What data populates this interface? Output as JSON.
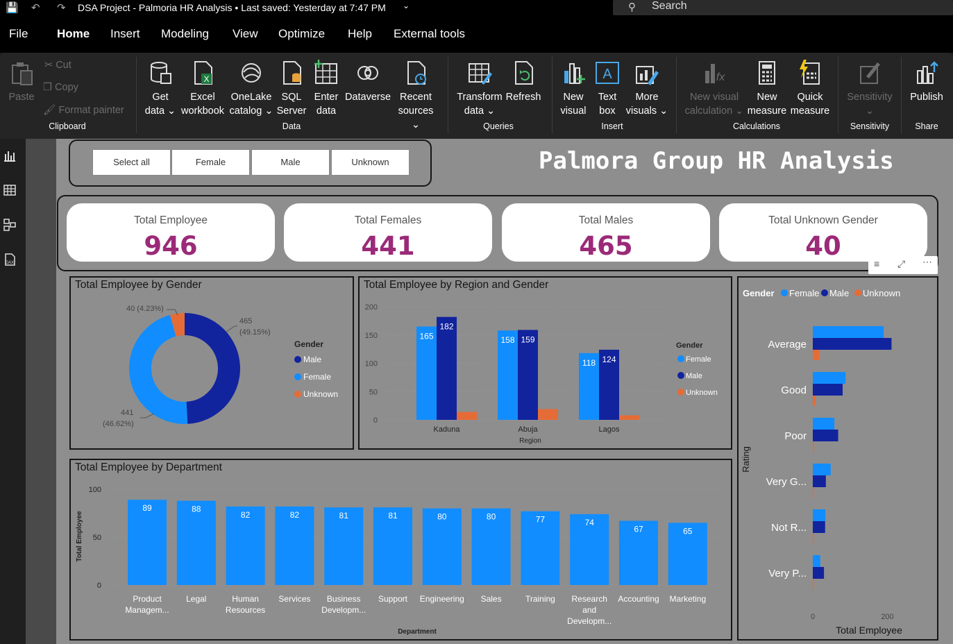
{
  "titlebar": {
    "title": "DSA Project - Palmoria HR Analysis • Last saved: Yesterday at 7:47 PM",
    "search": "Search"
  },
  "menu": [
    "File",
    "Home",
    "Insert",
    "Modeling",
    "View",
    "Optimize",
    "Help",
    "External tools"
  ],
  "ribbon": {
    "clipboard": {
      "paste": "Paste",
      "cut": "Cut",
      "copy": "Copy",
      "format_painter": "Format painter",
      "group": "Clipboard"
    },
    "data": {
      "get_data": [
        "Get",
        "data ⌄"
      ],
      "excel": [
        "Excel",
        "workbook"
      ],
      "onelake": [
        "OneLake",
        "catalog ⌄"
      ],
      "sql": [
        "SQL",
        "Server"
      ],
      "enter": [
        "Enter",
        "data"
      ],
      "dataverse": [
        "Dataverse"
      ],
      "recent": [
        "Recent",
        "sources ⌄"
      ],
      "group": "Data"
    },
    "queries": {
      "transform": [
        "Transform",
        "data ⌄"
      ],
      "refresh": [
        "Refresh"
      ],
      "group": "Queries"
    },
    "insert": {
      "new_visual": [
        "New",
        "visual"
      ],
      "text_box": [
        "Text",
        "box"
      ],
      "more_visuals": [
        "More",
        "visuals ⌄"
      ],
      "group": "Insert"
    },
    "calculations": {
      "new_visual_calc": [
        "New visual",
        "calculation ⌄"
      ],
      "new_measure": [
        "New",
        "measure"
      ],
      "quick_measure": [
        "Quick",
        "measure"
      ],
      "group": "Calculations"
    },
    "sensitivity": {
      "label": [
        "Sensitivity",
        "⌄"
      ],
      "group": "Sensitivity"
    },
    "share": {
      "publish": [
        "Publish"
      ],
      "group": "Share"
    }
  },
  "slicer": [
    "Select all",
    "Female",
    "Male",
    "Unknown"
  ],
  "report_title": "Palmora Group HR Analysis",
  "cards": [
    {
      "label": "Total Employee",
      "value": "946"
    },
    {
      "label": "Total Females",
      "value": "441"
    },
    {
      "label": "Total Males",
      "value": "465"
    },
    {
      "label": "Total Unknown Gender",
      "value": "40"
    }
  ],
  "colors": {
    "female": "#118dff",
    "male": "#12239e",
    "unknown": "#e66c37",
    "card_value": "#9b2a78"
  },
  "chart_data": [
    {
      "type": "pie",
      "title": "Total Employee by Gender",
      "legend_title": "Gender",
      "legend_position": "right",
      "slices": [
        {
          "label": "Male",
          "value": 465,
          "annotation": [
            "465",
            "(49.15%)"
          ]
        },
        {
          "label": "Female",
          "value": 441,
          "annotation": [
            "441",
            "(46.62%)"
          ]
        },
        {
          "label": "Unknown",
          "value": 40,
          "annotation": [
            "40 (4.23%)"
          ]
        }
      ]
    },
    {
      "type": "bar",
      "title": "Total Employee by Region and Gender",
      "xlabel": "Region",
      "legend_title": "Gender",
      "legend_position": "right",
      "categories": [
        "Kaduna",
        "Abuja",
        "Lagos"
      ],
      "yticks": [
        "200",
        "150",
        "100",
        "50",
        "0"
      ],
      "ylim": [
        0,
        200
      ],
      "series": [
        {
          "name": "Female",
          "values": [
            165,
            158,
            118
          ]
        },
        {
          "name": "Male",
          "values": [
            182,
            159,
            124
          ]
        },
        {
          "name": "Unknown",
          "values": [
            14,
            19,
            8
          ]
        }
      ]
    },
    {
      "type": "bar",
      "title": "Total Employee by Department",
      "xlabel": "Department",
      "ylabel": "Total Employee",
      "categories": [
        [
          "Product",
          "Managem..."
        ],
        [
          "Legal"
        ],
        [
          "Human",
          "Resources"
        ],
        [
          "Services"
        ],
        [
          "Business",
          "Developm..."
        ],
        [
          "Support"
        ],
        [
          "Engineering"
        ],
        [
          "Sales"
        ],
        [
          "Training"
        ],
        [
          "Research",
          "and",
          "Developm..."
        ],
        [
          "Accounting"
        ],
        [
          "Marketing"
        ]
      ],
      "values": [
        89,
        88,
        82,
        82,
        81,
        81,
        80,
        80,
        77,
        74,
        67,
        65
      ],
      "yticks": [
        "100",
        "50",
        "0"
      ],
      "ylim": [
        0,
        100
      ]
    },
    {
      "type": "bar",
      "orientation": "horizontal",
      "xlabel": "Total Employee",
      "ylabel": "Rating",
      "legend_title": "Gender",
      "legend_position": "top",
      "categories": [
        "Average",
        "Good",
        "Poor",
        "Very G...",
        "Not R...",
        "Very P..."
      ],
      "xticks": [
        "0",
        "200"
      ],
      "xlim": [
        0,
        240
      ],
      "series": [
        {
          "name": "Female",
          "values": [
            190,
            88,
            58,
            48,
            34,
            20
          ]
        },
        {
          "name": "Male",
          "values": [
            211,
            80,
            68,
            35,
            33,
            30
          ]
        },
        {
          "name": "Unknown",
          "values": [
            17,
            7,
            3,
            2,
            1,
            2
          ]
        }
      ]
    }
  ]
}
